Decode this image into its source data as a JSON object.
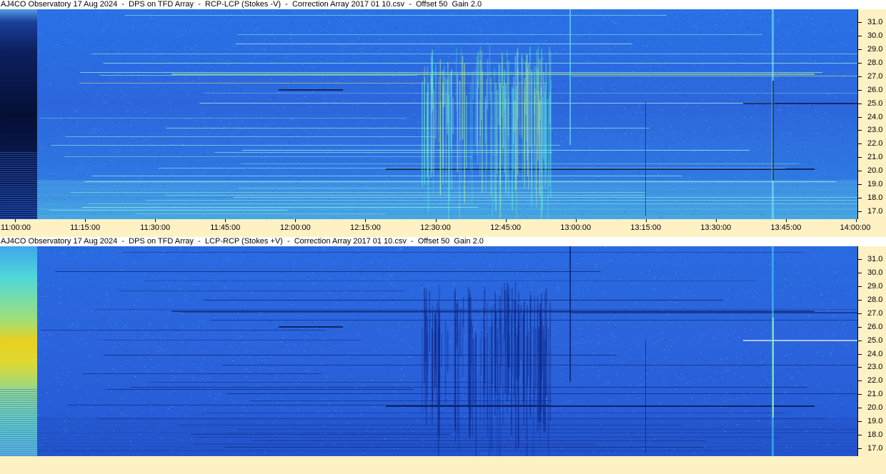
{
  "panels": [
    {
      "title": "AJ4CO Observatory 17 Aug 2024  -  DPS on TFD Array  -  RCP-LCP (Stokes -V)  -  Correction Array 2017 01 10.csv  -  Offset 50  Gain 2.0",
      "polarity": "-V"
    },
    {
      "title": "AJ4CO Observatory 17 Aug 2024  -  DPS on TFD Array  -  LCP-RCP (Stokes +V)  -  Correction Array 2017 01 10.csv  -  Offset 50  Gain 2.0",
      "polarity": "+V"
    }
  ],
  "freq_labels": [
    "31.0",
    "30.0",
    "29.0",
    "28.0",
    "27.0",
    "26.0",
    "25.0",
    "24.0",
    "23.0",
    "22.0",
    "21.0",
    "20.0",
    "19.0",
    "18.0",
    "17.0"
  ],
  "time_labels": [
    "11:00:00",
    "11:15:00",
    "11:30:00",
    "11:45:00",
    "12:00:00",
    "12:15:00",
    "12:30:00",
    "12:45:00",
    "13:00:00",
    "13:15:00",
    "13:30:00",
    "13:45:00",
    "14:00:00"
  ],
  "colors": {
    "axis_bg": "#fef1c4",
    "spectro_base": "#2f6fe0",
    "spectro_dark": "#0a1a6a",
    "spectro_bright": "#4fe3c8"
  }
}
